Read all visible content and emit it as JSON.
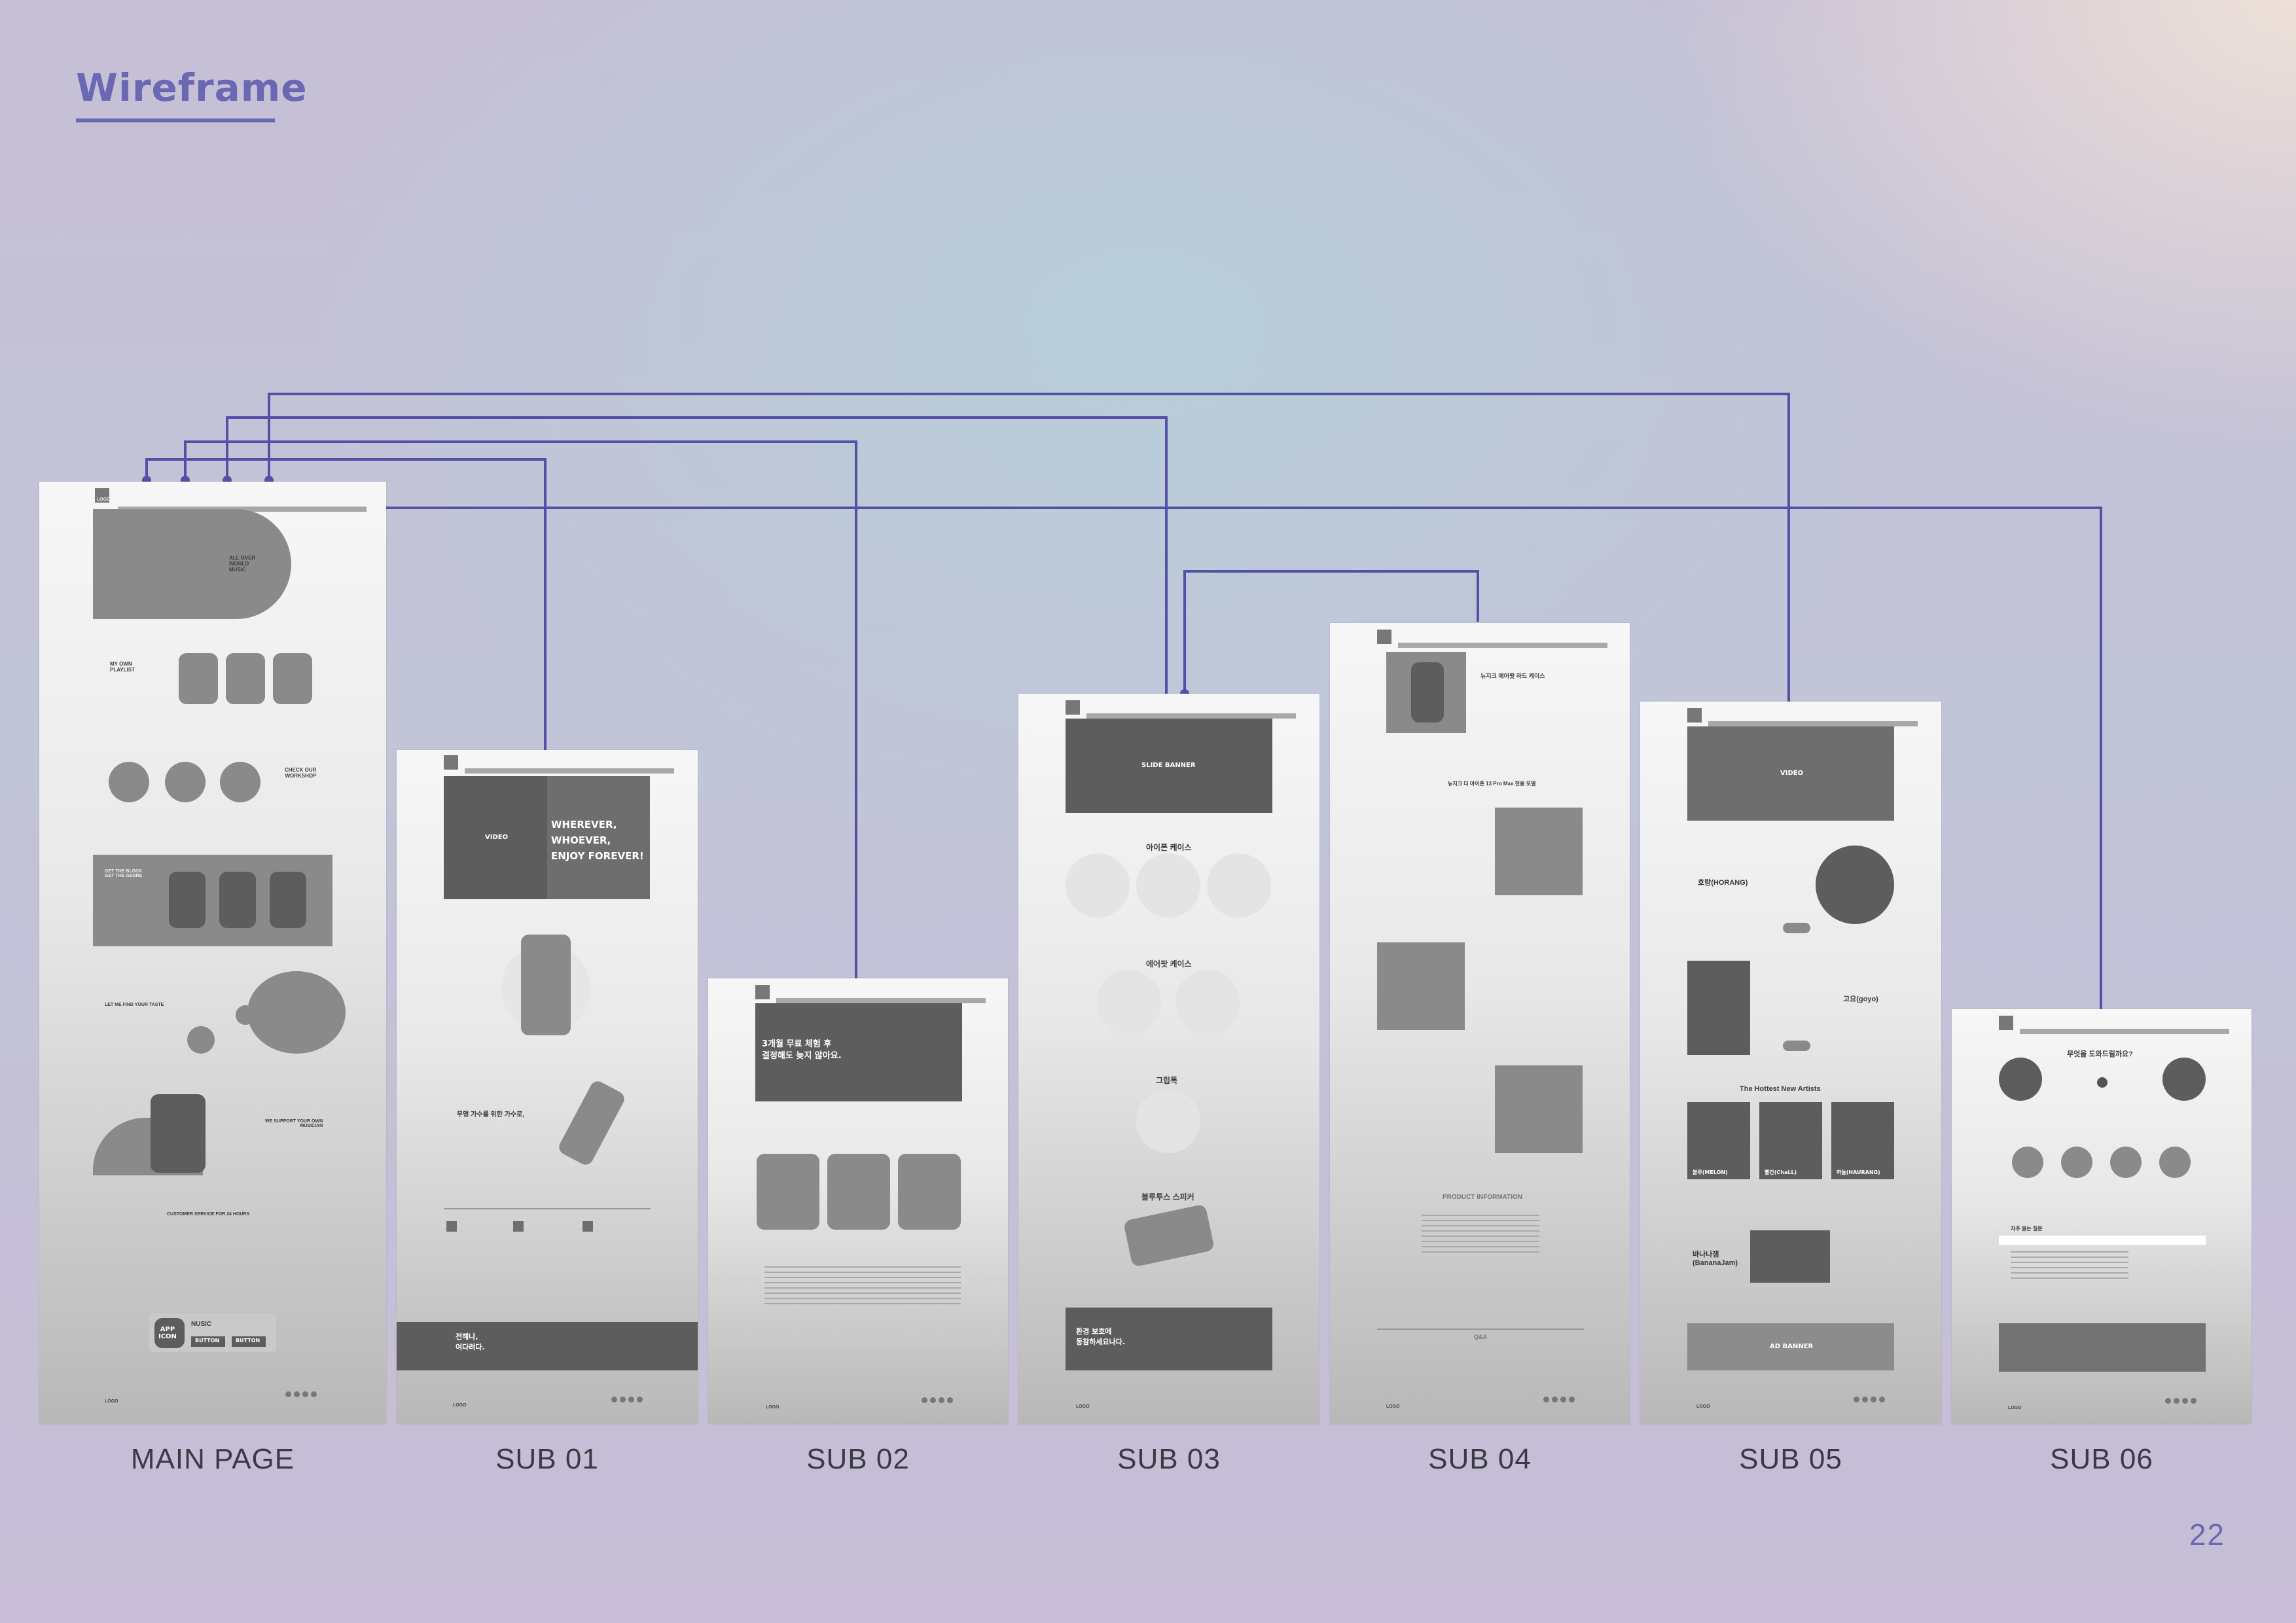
{
  "header": {
    "title": "Wireframe",
    "page_number": "22"
  },
  "colors": {
    "accent": "#6b68b3",
    "connector": "#5550a5",
    "block": "#6e6e6e"
  },
  "pages": [
    {
      "label": "MAIN PAGE"
    },
    {
      "label": "SUB 01"
    },
    {
      "label": "SUB 02"
    },
    {
      "label": "SUB 03"
    },
    {
      "label": "SUB 04"
    },
    {
      "label": "SUB 05"
    },
    {
      "label": "SUB 06"
    }
  ],
  "common": {
    "logo": "LOGO"
  },
  "main": {
    "hero": "ALL OVER\nWORLD\nMUSIC",
    "playlist": "MY OWN\nPLAYLIST",
    "workshop": "CHECK OUR\nWORKSHOP",
    "genre": "GET THE BLOCK\nGET THE GENRE",
    "taste": "LET ME FIND YOUR TASTE",
    "support": "WE SUPPORT YOUR OWN\nMUSICIAN",
    "service": "CUSTOMER SERVICE FOR 24 HOURS",
    "app_icon": "APP\nICON",
    "app_title": "NUSIC",
    "button1": "BUTTON",
    "button2": "BUTTON"
  },
  "sub01": {
    "video": "VIDEO",
    "slogan": "WHEREVER,\nWHOEVER,\nENJOY FOREVER!",
    "singer": "무명 가수를 위한 가수로,",
    "banner": "전해나,\n여다려다."
  },
  "sub02": {
    "headline": "3개월 무료 체험 후\n결정해도 늦지 않아요."
  },
  "sub03": {
    "slide": "SLIDE BANNER",
    "case1": "아이폰 케이스",
    "case2": "에어팟 케이스",
    "grip": "그립톡",
    "sticker": "블루투스 스피커",
    "banner": "환경 보호에\n동참하세요나다."
  },
  "sub04": {
    "product": "뉴지크 에어팟 하드 케이스",
    "desc": "뉴지크 더 아이폰 13 Pro Max 전용 모델",
    "info": "PRODUCT INFORMATION",
    "qna": "Q&A"
  },
  "sub05": {
    "video": "VIDEO",
    "artist1": "호랑(HORANG)",
    "artist2": "고요(goyo)",
    "hottest": "The Hottest New Artists",
    "a1": "블루(MELON)",
    "a2": "빨간(ChaLL)",
    "a3": "하늘(HAURANG)",
    "artist3": "바나나잼\n(BananaJam)",
    "ad": "AD BANNER"
  },
  "sub06": {
    "question": "무엇을 도와드릴까요?",
    "faq": "자주 묻는 질문"
  }
}
